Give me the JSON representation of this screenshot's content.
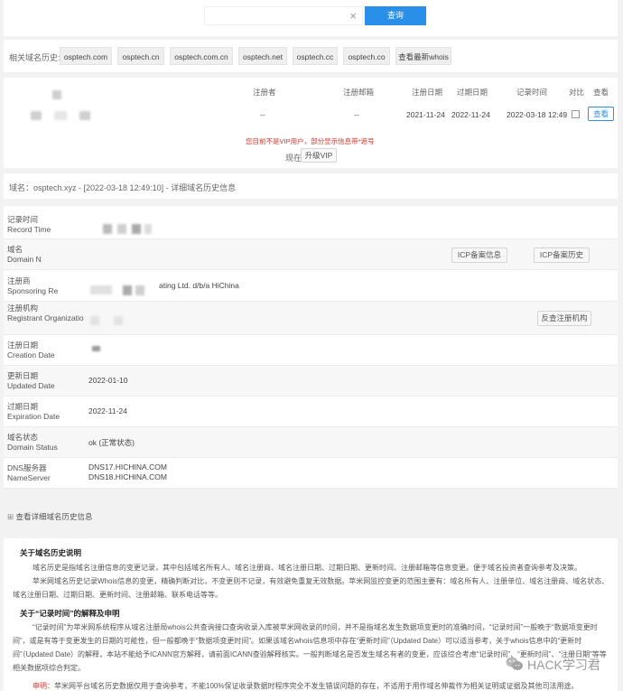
{
  "search": {
    "value": "",
    "clear_icon": "×",
    "button_label": "查询"
  },
  "history": {
    "label": "相关域名历史:",
    "chips": [
      "osptech.com",
      "osptech.cn",
      "osptech.com.cn",
      "osptech.net",
      "osptech.cc",
      "osptech.co",
      "查看最新whois"
    ]
  },
  "records_table": {
    "headers": [
      "注册者",
      "注册邮箱",
      "注册日期",
      "过期日期",
      "记录时间",
      "对比",
      "查看"
    ],
    "row": {
      "registrant": "--",
      "email": "--",
      "reg_date": "2021-11-24",
      "exp_date": "2022-11-24",
      "record_time": "2022-03-18 12:49",
      "view_label": "查看"
    },
    "vip_notice": "您目前不是VIP用户，部分显示信息带*遮号",
    "vip_prefix": "现在",
    "vip_button": "升级VIP"
  },
  "detail": {
    "header": "域名：osptech.xyz - [2022-03-18 12:49:10] - 详细域名历史信息",
    "fields": [
      {
        "cn": "记录时间",
        "en": "Record Time",
        "value": ""
      },
      {
        "cn": "域名",
        "en": "Domain N",
        "value": ""
      },
      {
        "cn": "注册商",
        "en": "Sponsoring Re",
        "value": "ating Ltd. d/b/a HiChina"
      },
      {
        "cn": "注册机构",
        "en": "Registrant Organizatio",
        "value": ""
      },
      {
        "cn": "注册日期",
        "en": "Creation Date",
        "value": ""
      },
      {
        "cn": "更新日期",
        "en": "Updated Date",
        "value": "2022-01-10"
      },
      {
        "cn": "过期日期",
        "en": "Expiration Date",
        "value": "2022-11-24"
      },
      {
        "cn": "域名状态",
        "en": "Domain Status",
        "value": "ok (正常状态)"
      },
      {
        "cn": "DNS服务器",
        "en": "NameServer",
        "value": "DNS17.HICHINA.COM",
        "value2": "DNS18.HICHINA.COM"
      }
    ],
    "icp_button": "ICP备案信息",
    "icp_history_button": "ICP备案历史",
    "reverse_button": "反查注册机构",
    "expand_icon": "⊞",
    "expand_label": "查看详细域名历史信息"
  },
  "about": {
    "title1": "关于域名历史说明",
    "p1": "域名历史是指域名注册信息的变更记录，其中包括域名所有人、域名注册商、域名注册日期、过期日期、更新时间、注册邮箱等信息变更。便于域名投资者查询参考及决策。",
    "p2": "苹米网域名历史记录Whois信息的变更，精确判断对比，不变更则不记录，有效避免重复无效数据。苹米网监控变更的范围主要有：域名所有人、注册单位、域名注册商、域名状态、域名注册日期、过期日期、更新时间、注册邮箱、联系电话等等。",
    "title2": "关于“记录时间”的解释及申明",
    "p3": "“记录时间”为苹米网系统程序从域名注册局whois公共查询接口查询收录入库被苹米网收录的时间，并不是指域名发生数据项变更时的准确时间，“记录时间”一般晚于“数据项变更时间”，或是有等于变更发生的日期的可能性，但一般都晚于“数据项变更时间”。如果该域名whois信息项中存在“更新时间”（Updated Date）可以适当参考，关于whois信息中的“更新时间”（Updated Date）的解释，本站不能给予ICANN官方解释，请前面ICANN查验解释核实。一般判断域名是否发生域名有者的变更，应该综合考虑“记录时间”、“更新时间”、“注册日期”等等相关数据项综合判定。",
    "p4_label": "申明：",
    "p4": "苹米网平台域名历史数据仅用于查询参考，不能100%保证收录数据时程序完全不发生错误问题的存在，不适用于用作域名伸裁作为相关证明或证据及其他司法用途。"
  },
  "watermark": {
    "brand": "HACK学习君",
    "icon": "wechat-icon"
  }
}
